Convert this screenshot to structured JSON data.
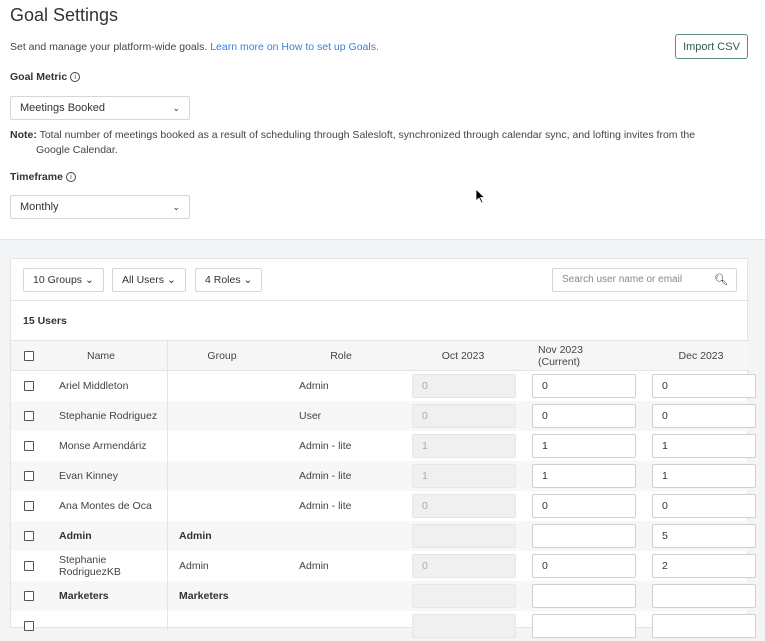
{
  "header": {
    "title": "Goal Settings",
    "subtitle": "Set and manage your platform-wide goals.",
    "help_link": "Learn more on How to set up Goals.",
    "import_button": "Import CSV"
  },
  "goal_metric": {
    "label": "Goal Metric",
    "value": "Meetings Booked",
    "note_label": "Note:",
    "note": "Total number of meetings booked as a result of scheduling through Salesloft, synchronized through calendar sync, and lofting invites from the Google Calendar."
  },
  "timeframe": {
    "label": "Timeframe",
    "value": "Monthly"
  },
  "filters": {
    "groups": "10 Groups",
    "users": "All Users",
    "roles": "4 Roles",
    "search_placeholder": "Search user name or email"
  },
  "user_count": "15 Users",
  "columns": [
    "Name",
    "Group",
    "Role",
    "Oct 2023",
    "Nov 2023 (Current)",
    "Dec 2023"
  ],
  "rows": [
    {
      "name": "Ariel Middleton",
      "group": "",
      "role": "Admin",
      "oct": "0",
      "nov": "0",
      "dec": "0",
      "is_group": false
    },
    {
      "name": "Stephanie Rodriguez",
      "group": "",
      "role": "User",
      "oct": "0",
      "nov": "0",
      "dec": "0",
      "is_group": false
    },
    {
      "name": "Monse Armendáriz",
      "group": "",
      "role": "Admin - lite",
      "oct": "1",
      "nov": "1",
      "dec": "1",
      "is_group": false
    },
    {
      "name": "Evan Kinney",
      "group": "",
      "role": "Admin - lite",
      "oct": "1",
      "nov": "1",
      "dec": "1",
      "is_group": false
    },
    {
      "name": "Ana Montes de Oca",
      "group": "",
      "role": "Admin - lite",
      "oct": "0",
      "nov": "0",
      "dec": "0",
      "is_group": false
    },
    {
      "name": "Admin",
      "group": "Admin",
      "role": "",
      "oct": "",
      "nov": "",
      "dec": "5",
      "is_group": true
    },
    {
      "name": "Stephanie RodriguezKB",
      "group": "Admin",
      "role": "Admin",
      "oct": "0",
      "nov": "0",
      "dec": "2",
      "is_group": false
    },
    {
      "name": "Marketers",
      "group": "Marketers",
      "role": "",
      "oct": "",
      "nov": "",
      "dec": "",
      "is_group": true
    },
    {
      "name": "",
      "group": "",
      "role": "",
      "oct": "",
      "nov": "",
      "dec": "",
      "is_group": false
    }
  ],
  "colors": {
    "link": "#3a7fd6",
    "import_border": "#5b8f7c",
    "background": "#f3f4f6"
  }
}
